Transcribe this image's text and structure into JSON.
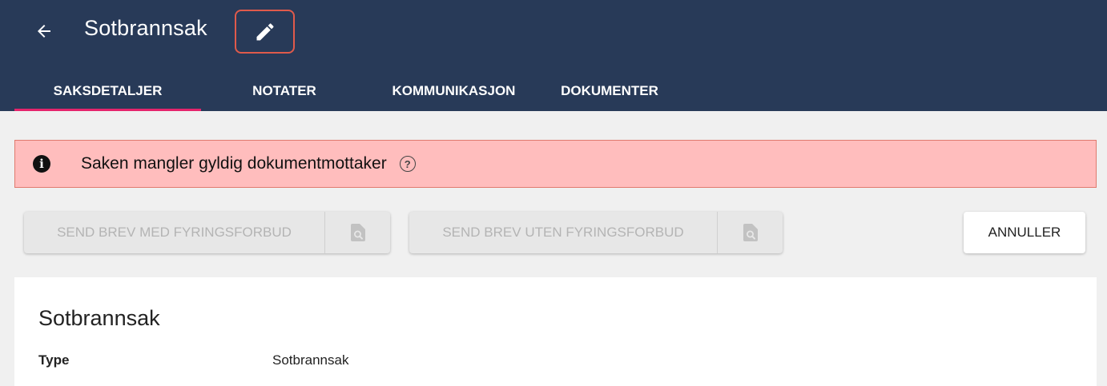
{
  "header": {
    "title": "Sotbrannsak",
    "back_icon": "arrow-left-icon",
    "edit_icon": "pencil-icon"
  },
  "tabs": [
    {
      "label": "SAKSDETALJER",
      "active": true
    },
    {
      "label": "NOTATER",
      "active": false
    },
    {
      "label": "KOMMUNIKASJON",
      "active": false
    },
    {
      "label": "DOKUMENTER",
      "active": false
    }
  ],
  "alert": {
    "icon": "info-icon",
    "text": "Saken mangler gyldig dokumentmottaker",
    "help_icon": "help-circle-icon"
  },
  "actions": {
    "send_with_ban": "SEND BREV MED FYRINGSFORBUD",
    "send_without_ban": "SEND BREV UTEN FYRINGSFORBUD",
    "preview_icon": "document-search-icon",
    "cancel": "ANNULLER"
  },
  "card": {
    "title": "Sotbrannsak",
    "fields": [
      {
        "label": "Type",
        "value": "Sotbrannsak"
      }
    ]
  },
  "colors": {
    "appbar": "#283a58",
    "tab_indicator": "#e5246c",
    "alert_bg": "#ffbdbd",
    "alert_border": "#e07a6e",
    "highlight_border": "#e05a4b"
  }
}
